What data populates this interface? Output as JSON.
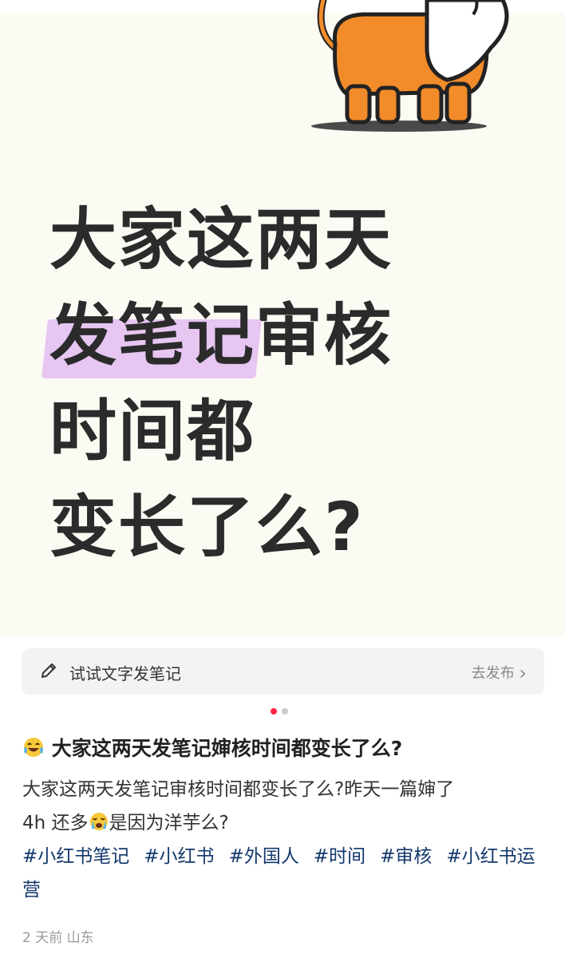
{
  "hero": {
    "headline_lines": [
      "大家这两天",
      "发笔记",
      "审核",
      "时间都",
      "变长了么?"
    ],
    "highlight_color": "#e7c6f2"
  },
  "write_bar": {
    "label": "试试文字发笔记",
    "action": "去发布",
    "chevron": "›"
  },
  "carousel": {
    "active_color": "#ff2442",
    "inactive_color": "#cccccc",
    "count": 2,
    "active_index": 0
  },
  "post": {
    "title_emoji": "laughing-tears-emoji",
    "title": "大家这两天发笔记婶核时间都变长了么?",
    "body_part1": "大家这两天发笔记审核时间都变长了么?昨天一篇婶了",
    "body_part2_prefix": "4h 还多",
    "body_emoji": "crying-face-emoji",
    "body_part2_suffix": "是因为洋芋么?",
    "tags": [
      "#小红书笔记",
      "#小红书",
      "#外国人",
      "#时间",
      "#审核",
      "#小红书运营"
    ],
    "meta": "2 天前  山东"
  }
}
